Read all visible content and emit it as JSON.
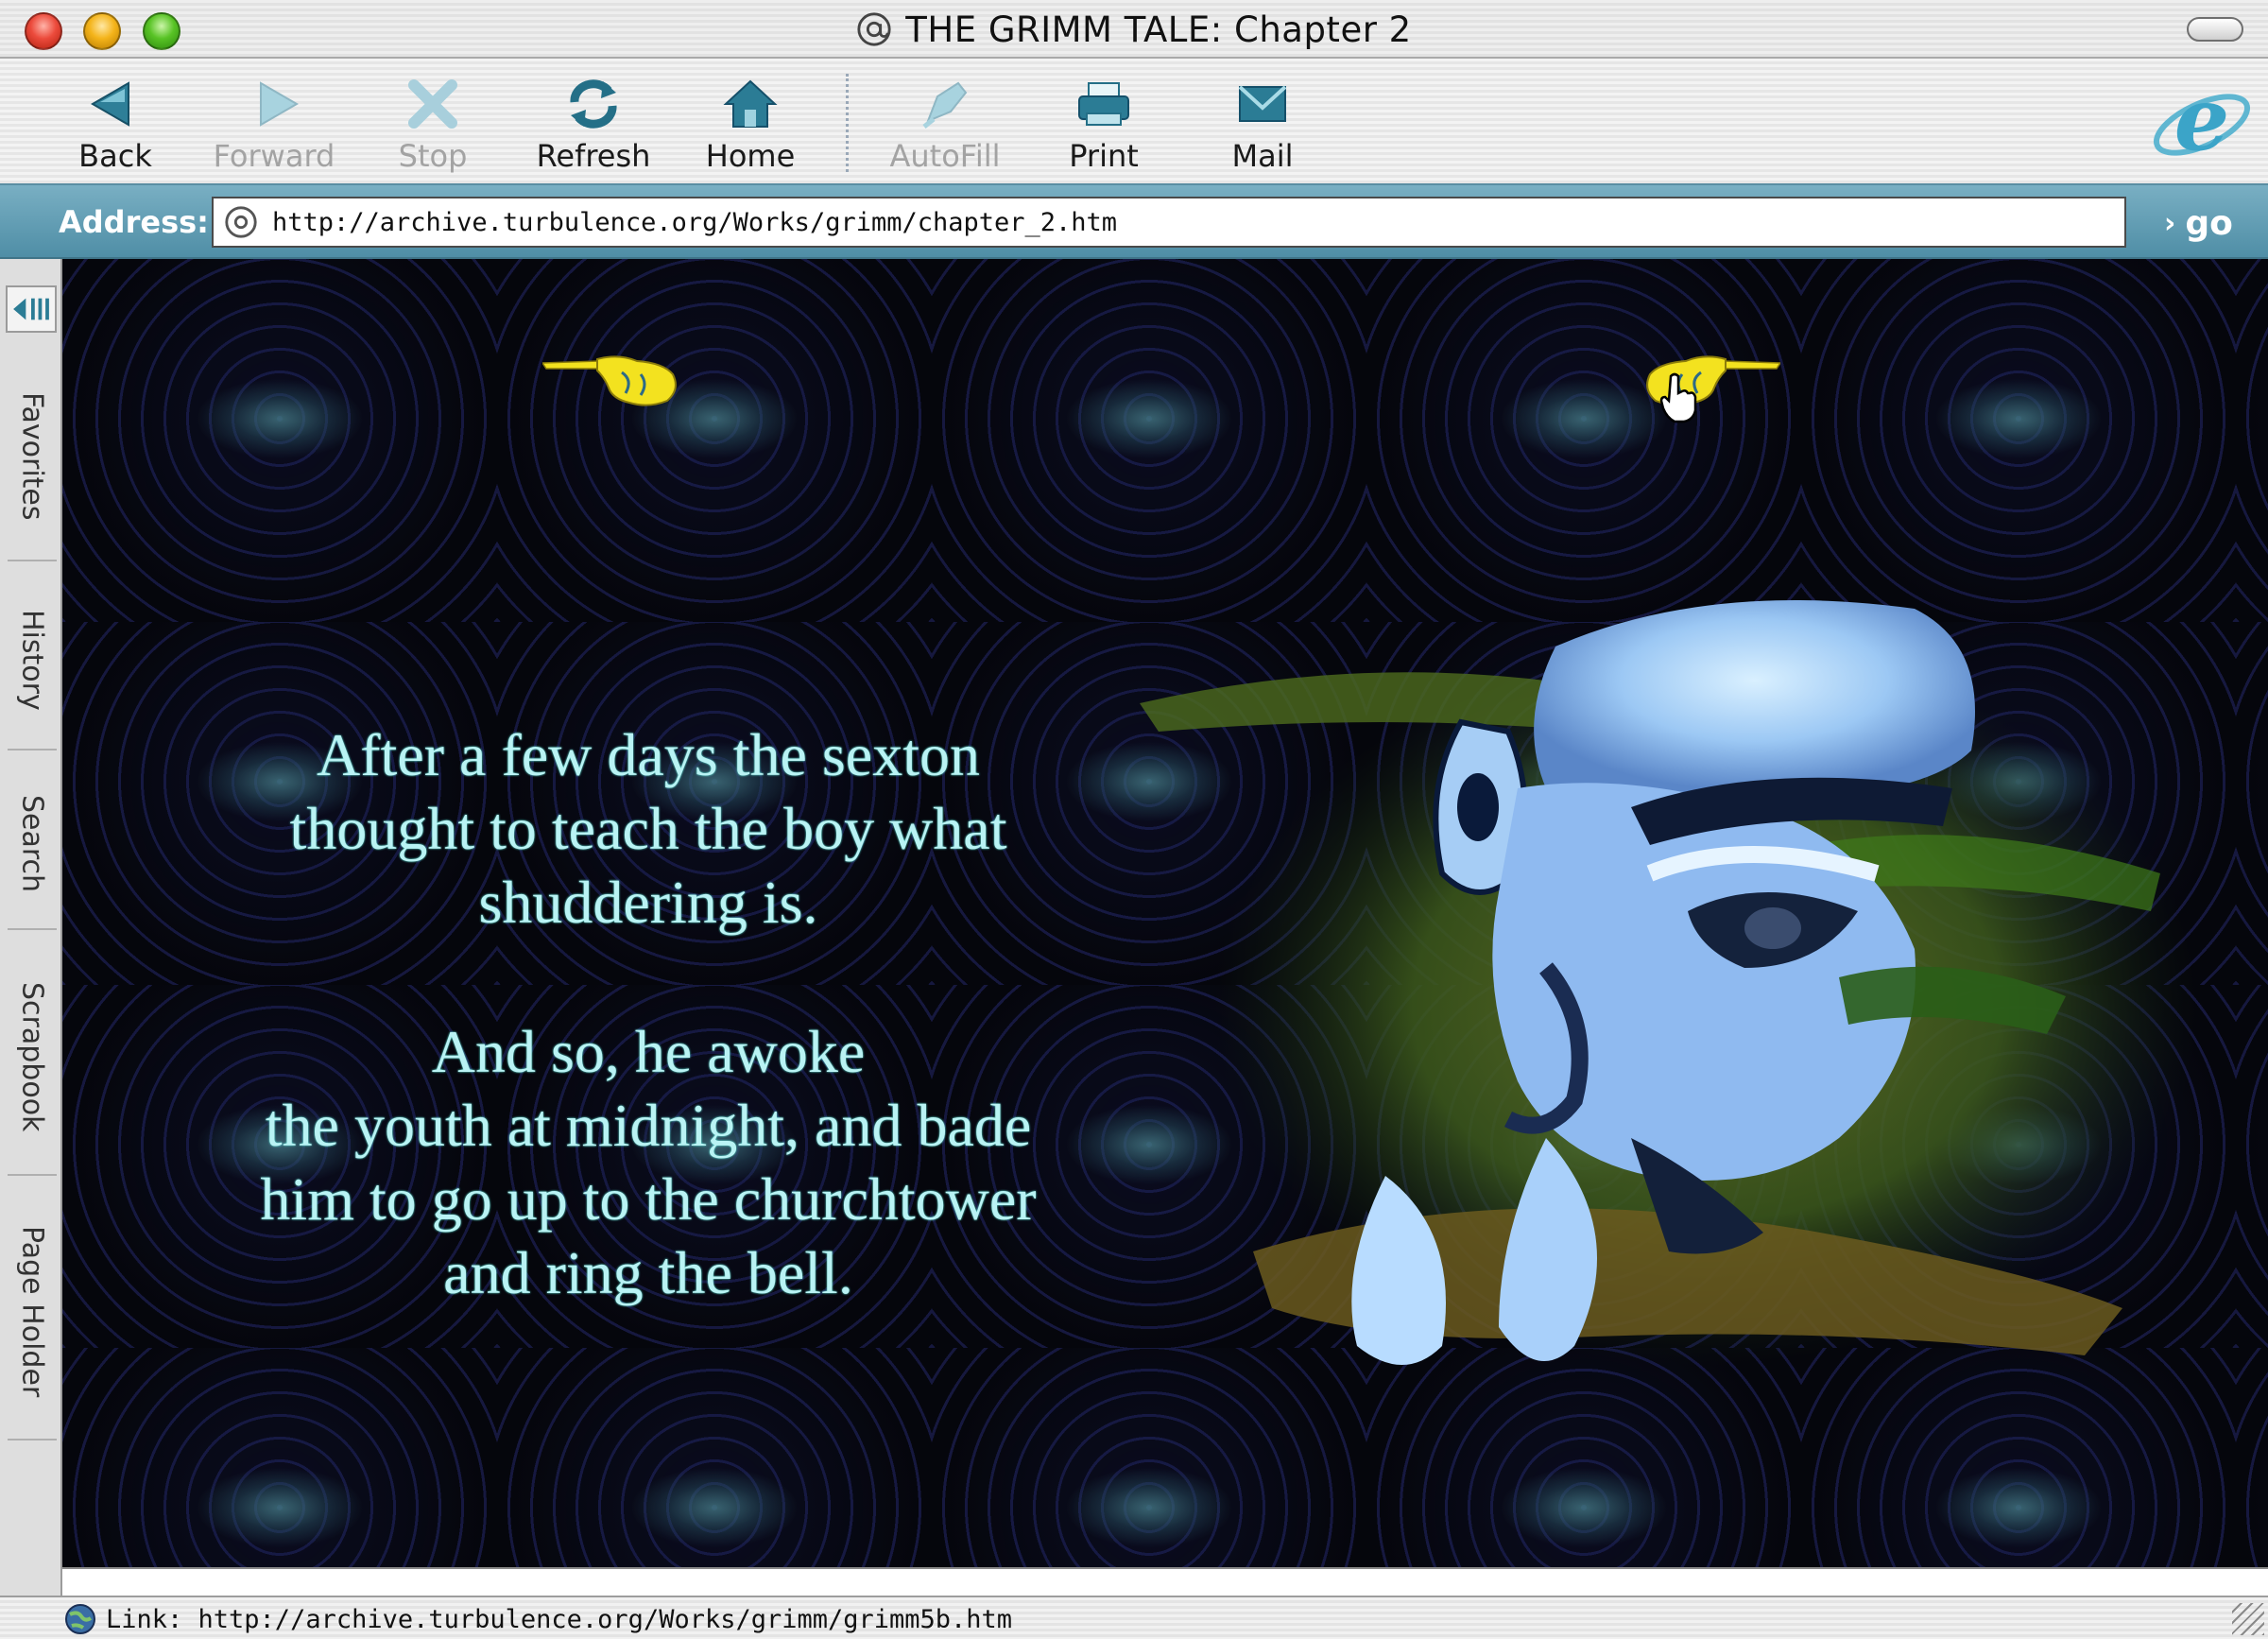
{
  "window": {
    "title": "THE GRIMM TALE: Chapter 2",
    "title_icon": "at-sign-icon"
  },
  "toolbar": {
    "buttons": [
      {
        "label": "Back",
        "icon": "back-arrow-icon",
        "enabled": true
      },
      {
        "label": "Forward",
        "icon": "forward-arrow-icon",
        "enabled": false
      },
      {
        "label": "Stop",
        "icon": "stop-x-icon",
        "enabled": false
      },
      {
        "label": "Refresh",
        "icon": "refresh-icon",
        "enabled": true
      },
      {
        "label": "Home",
        "icon": "home-icon",
        "enabled": true
      },
      {
        "label": "AutoFill",
        "icon": "autofill-icon",
        "enabled": false
      },
      {
        "label": "Print",
        "icon": "printer-icon",
        "enabled": true
      },
      {
        "label": "Mail",
        "icon": "mail-icon",
        "enabled": true
      }
    ]
  },
  "address": {
    "label": "Address:",
    "url": "http://archive.turbulence.org/Works/grimm/chapter_2.htm",
    "go_label": "go"
  },
  "sidebar": {
    "tabs": [
      "Favorites",
      "History",
      "Search",
      "Scrapbook",
      "Page Holder"
    ]
  },
  "page": {
    "paragraph1": [
      "After a few days the sexton",
      "thought to teach the boy what",
      "shuddering is."
    ],
    "paragraph2": [
      "And so, he awoke",
      "the youth at midnight, and bade",
      "him to go up to the churchtower",
      "and ring the bell."
    ]
  },
  "status": {
    "text": "Link: http://archive.turbulence.org/Works/grimm/grimm5b.htm"
  },
  "colors": {
    "story_text": "#b9f3f4",
    "address_bar": "#5d9db4",
    "page_background": "#05060c",
    "pointing_hand": "#f3e21f"
  }
}
